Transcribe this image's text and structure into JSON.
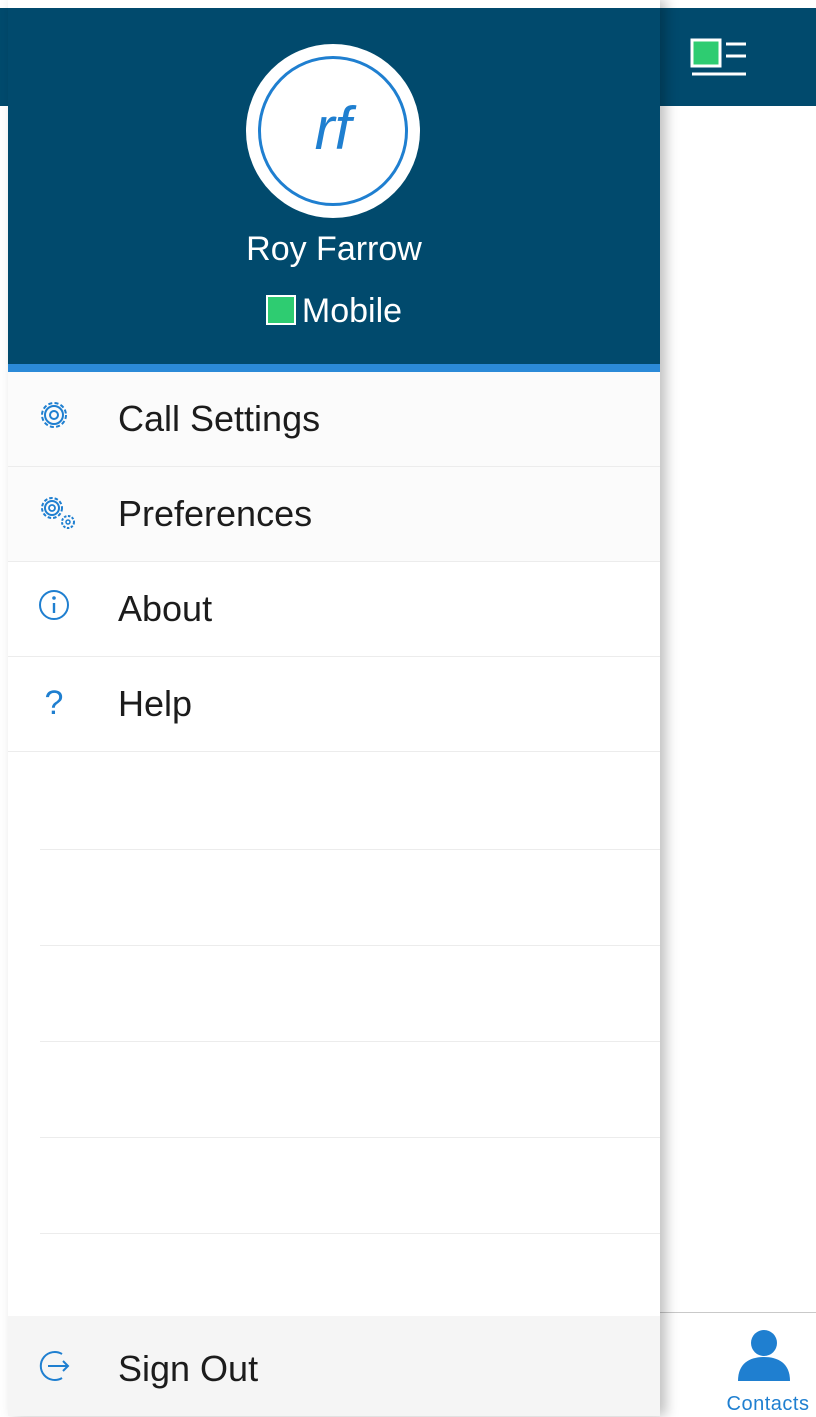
{
  "drawer": {
    "user_initials": "rf",
    "user_name": "Roy Farrow",
    "status_label": "Mobile",
    "status_color": "#2ecc71",
    "header_color": "#014a6d",
    "accent_color": "#2b8ad8"
  },
  "menu": {
    "items": [
      {
        "label": "Call Settings",
        "icon": "gear-icon"
      },
      {
        "label": "Preferences",
        "icon": "gears-icon"
      },
      {
        "label": "About",
        "icon": "info-icon"
      },
      {
        "label": "Help",
        "icon": "question-icon"
      }
    ],
    "sign_out": {
      "label": "Sign Out",
      "icon": "sign-out-icon"
    }
  },
  "tabbar": {
    "contacts_label": "Contacts"
  }
}
